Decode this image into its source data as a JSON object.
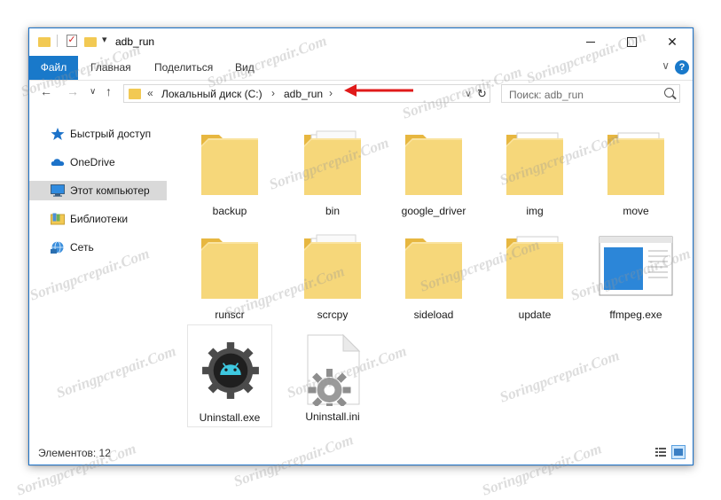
{
  "window": {
    "title": "adb_run",
    "controls": {
      "minimize": "",
      "maximize": "",
      "close": "✕"
    }
  },
  "ribbon": {
    "tabs": [
      {
        "label": "Файл",
        "active": true
      },
      {
        "label": "Главная"
      },
      {
        "label": "Поделиться"
      },
      {
        "label": "Вид"
      }
    ],
    "help": "?",
    "expand": "∨"
  },
  "nav": {
    "back": "←",
    "forward": "→",
    "dropdown": "∨",
    "up": "↑",
    "address": {
      "prefix": "«",
      "crumbs": [
        "Локальный диск (C:)",
        "adb_run"
      ],
      "separator": "›",
      "refresh": "↻",
      "dropdown": "∨"
    },
    "search": {
      "placeholder": "Поиск: adb_run",
      "value": ""
    }
  },
  "sidebar": {
    "items": [
      {
        "label": "Быстрый доступ",
        "icon": "star-icon"
      },
      {
        "label": "OneDrive",
        "icon": "cloud-icon"
      },
      {
        "label": "Этот компьютер",
        "icon": "computer-icon",
        "selected": true
      },
      {
        "label": "Библиотеки",
        "icon": "library-icon"
      },
      {
        "label": "Сеть",
        "icon": "network-icon"
      }
    ]
  },
  "files": [
    {
      "name": "backup",
      "type": "folder-empty"
    },
    {
      "name": "bin",
      "type": "folder-docs"
    },
    {
      "name": "google_driver",
      "type": "folder-empty"
    },
    {
      "name": "img",
      "type": "folder-images"
    },
    {
      "name": "move",
      "type": "folder-images"
    },
    {
      "name": "runscr",
      "type": "folder-empty"
    },
    {
      "name": "scrcpy",
      "type": "folder-docs"
    },
    {
      "name": "sideload",
      "type": "folder-empty"
    },
    {
      "name": "update",
      "type": "folder-images"
    },
    {
      "name": "ffmpeg.exe",
      "type": "exe-window"
    },
    {
      "name": "Uninstall.exe",
      "type": "exe-android",
      "selected": true
    },
    {
      "name": "Uninstall.ini",
      "type": "ini-gear"
    }
  ],
  "status": {
    "count_text": "Элементов: 12"
  },
  "watermark": "Soringpcrepair.Com",
  "colors": {
    "accent": "#1979ca",
    "folder": "#f2c953",
    "annotation_arrow": "#e01a1a"
  }
}
